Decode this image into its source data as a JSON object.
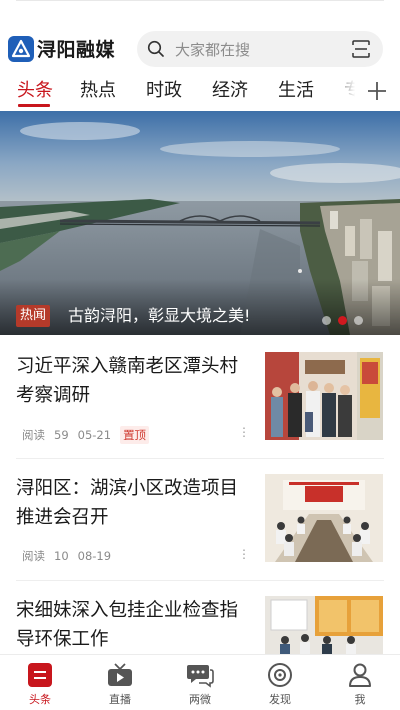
{
  "app": {
    "name": "浔阳融媒"
  },
  "search": {
    "placeholder": "大家都在搜"
  },
  "tabs": [
    {
      "label": "头条",
      "active": true
    },
    {
      "label": "热点"
    },
    {
      "label": "时政"
    },
    {
      "label": "经济"
    },
    {
      "label": "生活"
    },
    {
      "label": "专"
    }
  ],
  "banner": {
    "tag": "热闻",
    "title": "古韵浔阳，彰显大境之美!",
    "slide_count": 3,
    "active_slide": 2
  },
  "news": [
    {
      "title": "习近平深入赣南老区潭头村考察调研",
      "reads_label": "阅读",
      "reads": "59",
      "date": "05-21",
      "pinned_label": "置顶",
      "more": "⋮",
      "thumb_icon": "photo-visit-icon"
    },
    {
      "title": "浔阳区：湖滨小区改造项目推进会召开",
      "reads_label": "阅读",
      "reads": "10",
      "date": "08-19",
      "more": "⋮",
      "thumb_icon": "photo-meeting-icon"
    },
    {
      "title": "宋细妹深入包挂企业检查指导环保工作",
      "thumb_icon": "photo-inspection-icon"
    }
  ],
  "bottom_nav": [
    {
      "label": "头条",
      "icon": "headline-icon",
      "active": true
    },
    {
      "label": "直播",
      "icon": "tv-icon"
    },
    {
      "label": "两微",
      "icon": "chat-icon"
    },
    {
      "label": "发现",
      "icon": "discover-icon"
    },
    {
      "label": "我",
      "icon": "user-icon"
    }
  ],
  "colors": {
    "accent": "#c8161d",
    "logo": "#1f5fb8",
    "tag": "#b53a2a"
  }
}
